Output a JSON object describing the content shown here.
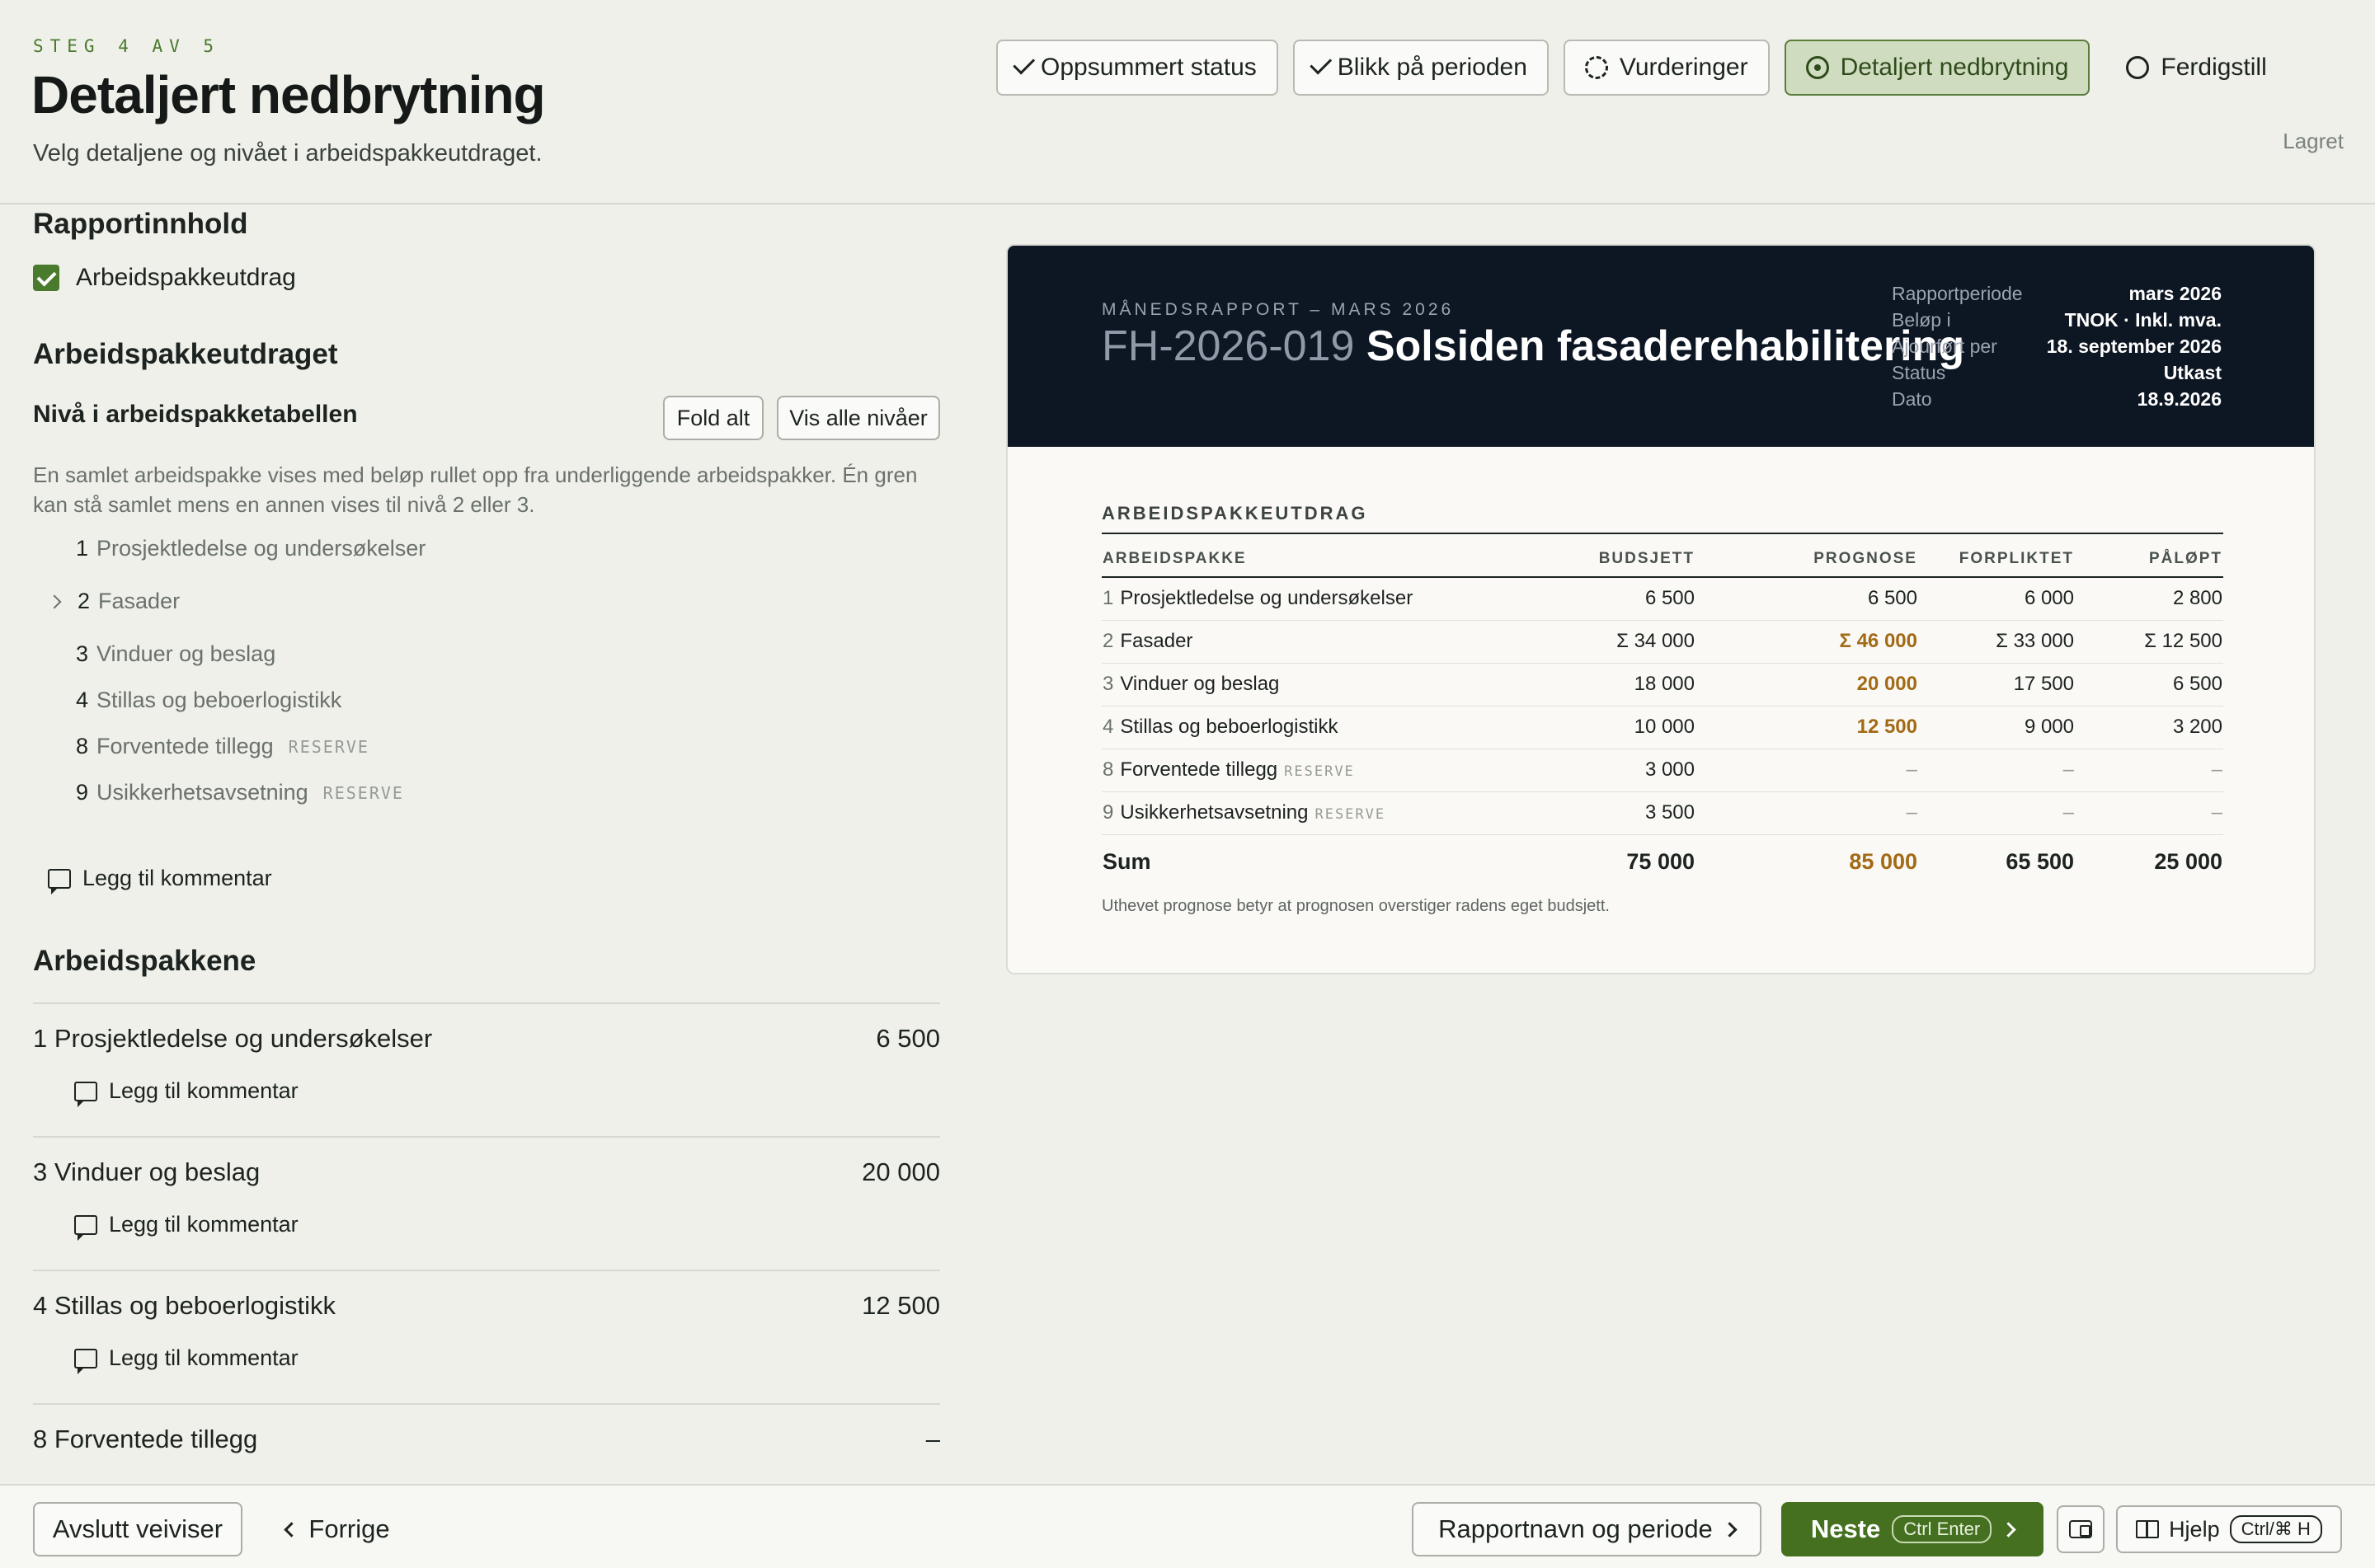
{
  "header": {
    "step_label": "STEG 4 AV 5",
    "title": "Detaljert nedbrytning",
    "subtitle": "Velg detaljene og nivået i arbeidspakkeutdraget.",
    "saved_status": "Lagret",
    "steps": [
      {
        "label": "Oppsummert status",
        "state": "done",
        "icon": "check-icon"
      },
      {
        "label": "Blikk på perioden",
        "state": "done",
        "icon": "check-icon"
      },
      {
        "label": "Vurderinger",
        "state": "in-progress",
        "icon": "dashed-circle-icon"
      },
      {
        "label": "Detaljert nedbrytning",
        "state": "active",
        "icon": "radio-dot-icon"
      },
      {
        "label": "Ferdigstill",
        "state": "todo",
        "icon": "empty-circle-icon"
      }
    ]
  },
  "left": {
    "content_heading": "Rapportinnhold",
    "content_checkbox_label": "Arbeidspakkeutdrag",
    "content_checkbox_checked": true,
    "extract_heading": "Arbeidspakkeutdraget",
    "level_heading": "Nivå i arbeidspakketabellen",
    "fold_button": "Fold alt",
    "show_levels_button": "Vis alle nivåer",
    "description": "En samlet arbeidspakke vises med beløp rullet opp fra underliggende arbeidspakker. Én gren kan stå samlet mens en annen vises til nivå 2 eller 3.",
    "tree": [
      {
        "num": "1",
        "label": "Prosjektledelse og undersøkelser",
        "tag": "",
        "expandable": false
      },
      {
        "num": "2",
        "label": "Fasader",
        "tag": "",
        "expandable": true
      },
      {
        "num": "3",
        "label": "Vinduer og beslag",
        "tag": "",
        "expandable": false
      },
      {
        "num": "4",
        "label": "Stillas og beboerlogistikk",
        "tag": "",
        "expandable": false
      },
      {
        "num": "8",
        "label": "Forventede tillegg",
        "tag": "RESERVE",
        "expandable": false
      },
      {
        "num": "9",
        "label": "Usikkerhetsavsetning",
        "tag": "RESERVE",
        "expandable": false
      }
    ],
    "comment_label": "Legg til kommentar",
    "packages_heading": "Arbeidspakkene",
    "packages": [
      {
        "title": "1 Prosjektledelse og undersøkelser",
        "value": "6 500"
      },
      {
        "title": "3 Vinduer og beslag",
        "value": "20 000"
      },
      {
        "title": "4 Stillas og beboerlogistikk",
        "value": "12 500"
      },
      {
        "title": "8 Forventede tillegg",
        "value": "–"
      }
    ]
  },
  "report": {
    "eyebrow": "MÅNEDSRAPPORT – MARS 2026",
    "code": "FH-2026-019",
    "name": "Solsiden fasaderehabilitering",
    "meta": [
      {
        "key": "Rapportperiode",
        "value": "mars 2026"
      },
      {
        "key": "Beløp i",
        "value": "TNOK · Inkl. mva."
      },
      {
        "key": "Ajourført per",
        "value": "18. september 2026"
      },
      {
        "key": "Status",
        "value": "Utkast"
      },
      {
        "key": "Dato",
        "value": "18.9.2026"
      }
    ],
    "section_title": "ARBEIDSPAKKEUTDRAG",
    "columns": [
      "ARBEIDSPAKKE",
      "BUDSJETT",
      "PROGNOSE",
      "FORPLIKTET",
      "PÅLØPT"
    ],
    "rows": [
      {
        "num": "1",
        "name": "Prosjektledelse og undersøkelser",
        "tag": "",
        "budget": "6 500",
        "forecast": "6 500",
        "over": false,
        "committed": "6 000",
        "accrued": "2 800"
      },
      {
        "num": "2",
        "name": "Fasader",
        "tag": "",
        "budget": "Σ 34 000",
        "forecast": "Σ 46 000",
        "over": true,
        "committed": "Σ 33 000",
        "accrued": "Σ 12 500"
      },
      {
        "num": "3",
        "name": "Vinduer og beslag",
        "tag": "",
        "budget": "18 000",
        "forecast": "20 000",
        "over": true,
        "committed": "17 500",
        "accrued": "6 500"
      },
      {
        "num": "4",
        "name": "Stillas og beboerlogistikk",
        "tag": "",
        "budget": "10 000",
        "forecast": "12 500",
        "over": true,
        "committed": "9 000",
        "accrued": "3 200"
      },
      {
        "num": "8",
        "name": "Forventede tillegg",
        "tag": "RESERVE",
        "budget": "3 000",
        "forecast": "–",
        "over": false,
        "committed": "–",
        "accrued": "–"
      },
      {
        "num": "9",
        "name": "Usikkerhetsavsetning",
        "tag": "RESERVE",
        "budget": "3 500",
        "forecast": "–",
        "over": false,
        "committed": "–",
        "accrued": "–"
      }
    ],
    "sum": {
      "label": "Sum",
      "budget": "75 000",
      "forecast": "85 000",
      "committed": "65 500",
      "accrued": "25 000"
    },
    "note": "Uthevet prognose betyr at prognosen overstiger radens eget budsjett."
  },
  "footer": {
    "exit": "Avslutt veiviser",
    "previous": "Forrige",
    "report_name": "Rapportnavn og periode",
    "next": "Neste",
    "next_shortcut": "Ctrl Enter",
    "help": "Hjelp",
    "help_shortcut": "Ctrl/⌘ H"
  },
  "colors": {
    "accent": "#44701f",
    "over_budget": "#a36a16",
    "report_header": "#0d1623"
  }
}
